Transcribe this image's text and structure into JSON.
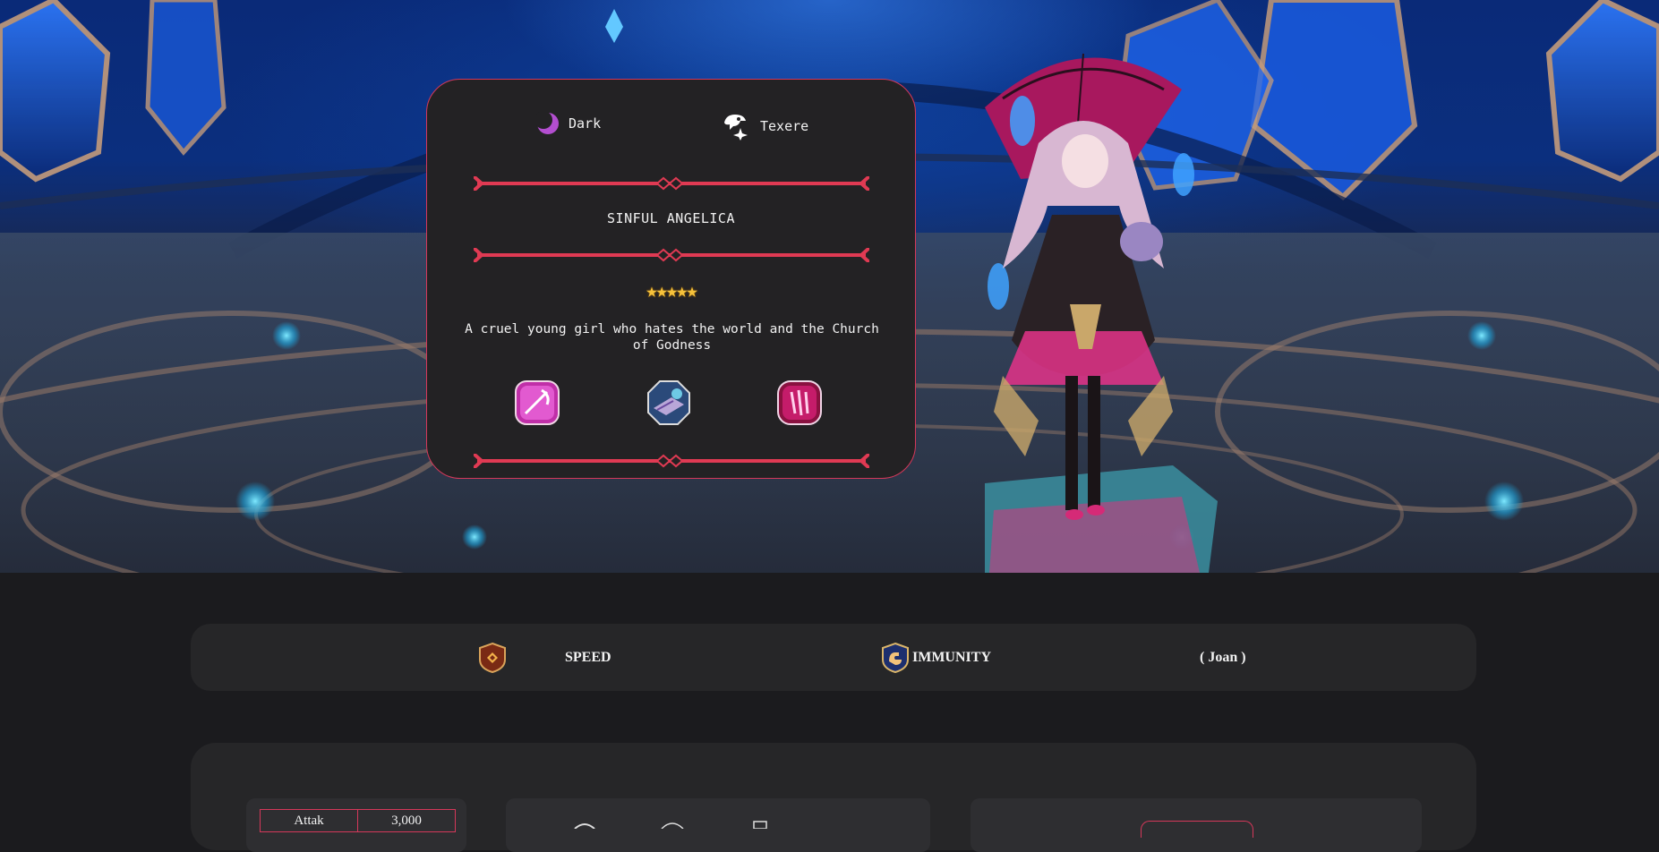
{
  "hero": {
    "element": {
      "label": "Dark",
      "icon": "dark-moon-icon"
    },
    "class": {
      "label": "Texere",
      "icon": "texere-class-icon"
    },
    "name": "SINFUL ANGELICA",
    "stars": "★★★★★",
    "rating": 5,
    "description": "A cruel young girl who hates the world and the Church of Godness",
    "skills": [
      {
        "icon": "scythe-skill-icon"
      },
      {
        "icon": "book-skill-icon"
      },
      {
        "icon": "claw-skill-icon"
      }
    ]
  },
  "info_bar": {
    "speed_label": "SPEED",
    "speed_icon": "speed-set-icon",
    "immunity_label": "IMMUNITY",
    "immunity_icon": "immunity-set-icon",
    "artifact_label": "( Joan )"
  },
  "stats": {
    "rows": [
      {
        "label": "Attak",
        "value": "3,000"
      }
    ]
  },
  "colors": {
    "accent": "#d5385a",
    "card_bg": "#232224",
    "page_bg": "#1b1b1e",
    "panel_bg": "#262628",
    "stars": "#f6c23b"
  }
}
